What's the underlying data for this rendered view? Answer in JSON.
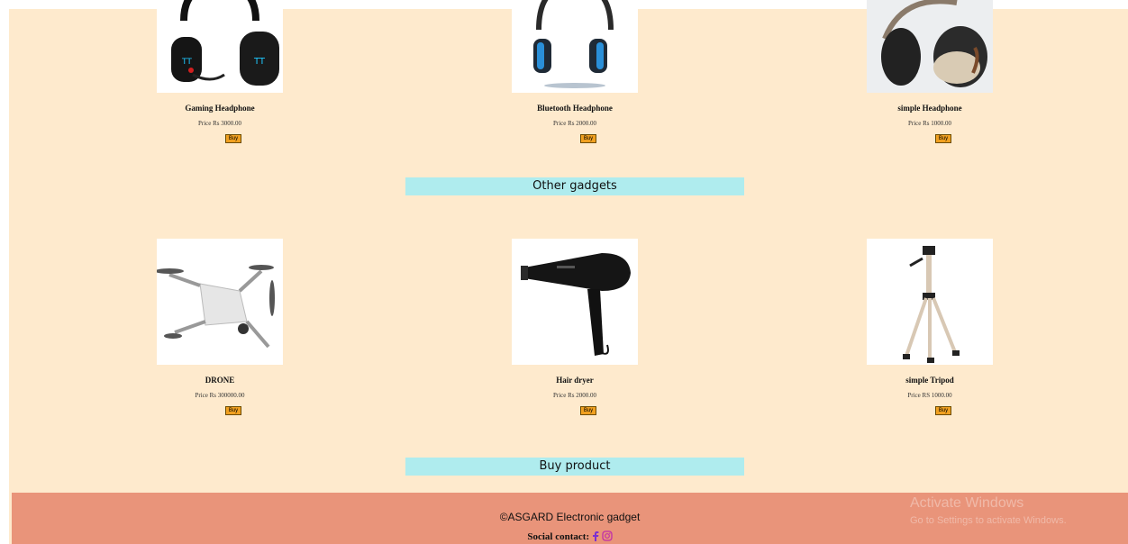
{
  "headphones": [
    {
      "name": "Gaming Headphone",
      "price": "Price Rs 3000.00",
      "buy": "Buy",
      "icon": "gaming-headphone-image"
    },
    {
      "name": "Bluetooth Headphone",
      "price": "Price Rs 2000.00",
      "buy": "Buy",
      "icon": "bluetooth-headphone-image"
    },
    {
      "name": "simple Headphone",
      "price": "Price Rs 1000.00",
      "buy": "Buy",
      "icon": "simple-headphone-image"
    }
  ],
  "other_gadgets_title": "Other gadgets",
  "gadgets": [
    {
      "name": "DRONE",
      "price": "Price Rs 300000.00",
      "buy": "Buy",
      "icon": "drone-image"
    },
    {
      "name": "Hair dryer",
      "price": "Price Rs 2000.00",
      "buy": "Buy",
      "icon": "hair-dryer-image"
    },
    {
      "name": "simple Tripod",
      "price": "Price RS 1000.00",
      "buy": "Buy",
      "icon": "tripod-image"
    }
  ],
  "buy_product_title": "Buy product",
  "footer": {
    "copyright": "©ASGARD Electronic gadget",
    "social_label": "Social contact:"
  },
  "watermark": {
    "line1": "Activate Windows",
    "line2": "Go to Settings to activate Windows."
  },
  "colors": {
    "page_bg": "#feeacd",
    "section_bg": "#afecee",
    "footer_bg": "#e9947a",
    "buy_button": "#f0a020",
    "facebook": "#7b2fd0",
    "instagram": "#c02fa8"
  }
}
